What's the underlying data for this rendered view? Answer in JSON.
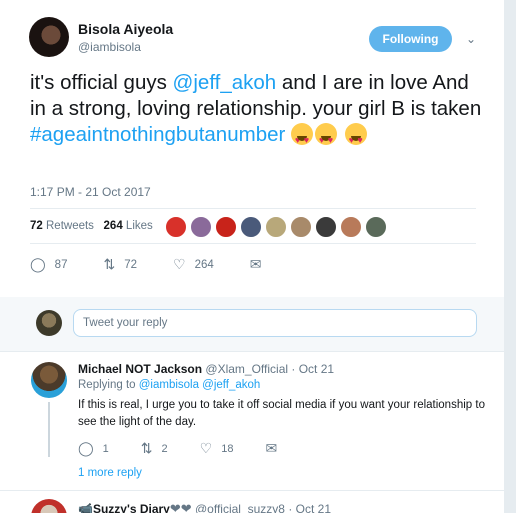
{
  "tweet": {
    "display_name": "Bisola Aiyeola",
    "handle": "@iambisola",
    "follow_label": "Following",
    "text_1": "it's official guys ",
    "mention": "@jeff_akoh",
    "text_2": " and I are in love And in a strong, loving relationship. your girl B is taken ",
    "hashtag": "#ageaintnothingbutanumber",
    "timestamp": "1:17 PM - 21 Oct 2017",
    "retweets_count": "72",
    "retweets_label": "Retweets",
    "likes_count": "264",
    "likes_label": "Likes",
    "reply_count": "87",
    "rt_count": "72",
    "like_count": "264"
  },
  "reply_box": {
    "placeholder": "Tweet your reply"
  },
  "reply": {
    "name": "Michael NOT Jackson",
    "meta": "@Xlam_Official · Oct 21",
    "replying_prefix": "Replying to ",
    "replying_to": "@iambisola @jeff_akoh",
    "text": "If this is real, I urge you to take it off social media if you want your relationship to see the light of the day.",
    "reply_count": "1",
    "rt_count": "2",
    "like_count": "18",
    "more_replies": "1 more reply"
  },
  "next_reply": {
    "name": "Suzzy's Diary",
    "hearts": "❤❤",
    "meta": "@official_suzzy8 · Oct 21"
  },
  "colors": {
    "link": "#1da1f2",
    "follow_bg": "#5fb4ec",
    "muted": "#657786"
  }
}
